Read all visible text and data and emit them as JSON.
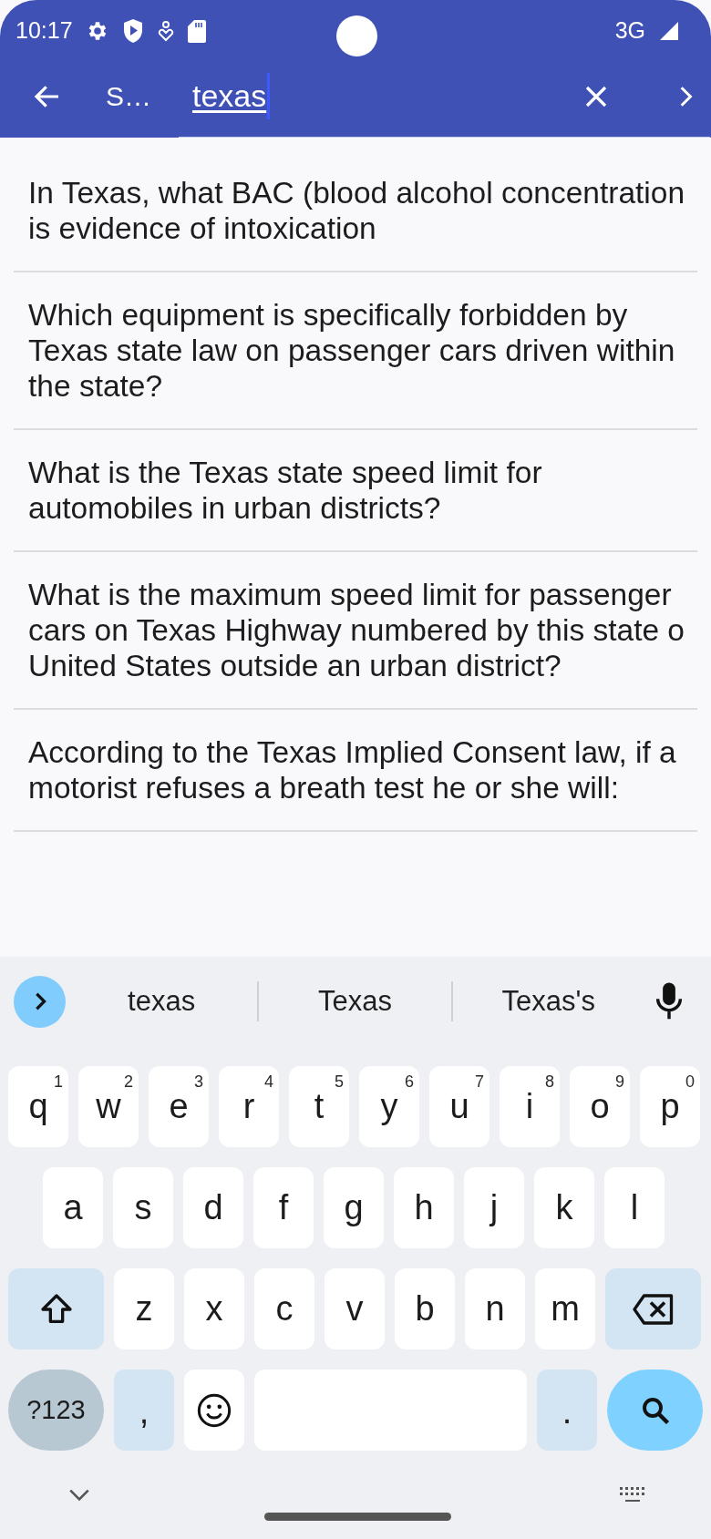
{
  "status_bar": {
    "time": "10:17",
    "network": "3G"
  },
  "app_bar": {
    "title": "S…",
    "search": {
      "value": "texas"
    }
  },
  "results": [
    {
      "text": "In Texas, what BAC (blood alcohol concentration\nis evidence of intoxication"
    },
    {
      "text": "Which equipment is specifically forbidden by\nTexas state law on passenger cars driven within\nthe state?"
    },
    {
      "text": "What is the Texas state speed limit for\nautomobiles in urban districts?"
    },
    {
      "text": "What is the maximum speed limit for passenger\ncars on Texas Highway numbered by this state o\nUnited States outside an urban district?"
    },
    {
      "text": "According to the Texas Implied Consent law, if a\nmotorist refuses a breath test he or she will:"
    }
  ],
  "keyboard": {
    "suggestions": [
      {
        "text": "texas"
      },
      {
        "text": "Texas"
      },
      {
        "text": "Texas's"
      }
    ],
    "rows": [
      {
        "keys": [
          {
            "kind": "letter",
            "label": "q",
            "hint": "1"
          },
          {
            "kind": "letter",
            "label": "w",
            "hint": "2"
          },
          {
            "kind": "letter",
            "label": "e",
            "hint": "3"
          },
          {
            "kind": "letter",
            "label": "r",
            "hint": "4"
          },
          {
            "kind": "letter",
            "label": "t",
            "hint": "5"
          },
          {
            "kind": "letter",
            "label": "y",
            "hint": "6"
          },
          {
            "kind": "letter",
            "label": "u",
            "hint": "7"
          },
          {
            "kind": "letter",
            "label": "i",
            "hint": "8"
          },
          {
            "kind": "letter",
            "label": "o",
            "hint": "9"
          },
          {
            "kind": "letter",
            "label": "p",
            "hint": "0"
          }
        ]
      },
      {
        "keys": [
          {
            "kind": "letter",
            "label": "a"
          },
          {
            "kind": "letter",
            "label": "s"
          },
          {
            "kind": "letter",
            "label": "d"
          },
          {
            "kind": "letter",
            "label": "f"
          },
          {
            "kind": "letter",
            "label": "g"
          },
          {
            "kind": "letter",
            "label": "h"
          },
          {
            "kind": "letter",
            "label": "j"
          },
          {
            "kind": "letter",
            "label": "k"
          },
          {
            "kind": "letter",
            "label": "l"
          }
        ]
      },
      {
        "keys": [
          {
            "kind": "shift"
          },
          {
            "kind": "letter",
            "label": "z"
          },
          {
            "kind": "letter",
            "label": "x"
          },
          {
            "kind": "letter",
            "label": "c"
          },
          {
            "kind": "letter",
            "label": "v"
          },
          {
            "kind": "letter",
            "label": "b"
          },
          {
            "kind": "letter",
            "label": "n"
          },
          {
            "kind": "letter",
            "label": "m"
          },
          {
            "kind": "backspace"
          }
        ]
      },
      {
        "keys": [
          {
            "kind": "symbols",
            "label": "?123"
          },
          {
            "kind": "punct",
            "label": ","
          },
          {
            "kind": "emoji"
          },
          {
            "kind": "space"
          },
          {
            "kind": "punct",
            "label": "."
          },
          {
            "kind": "search"
          }
        ]
      }
    ]
  }
}
